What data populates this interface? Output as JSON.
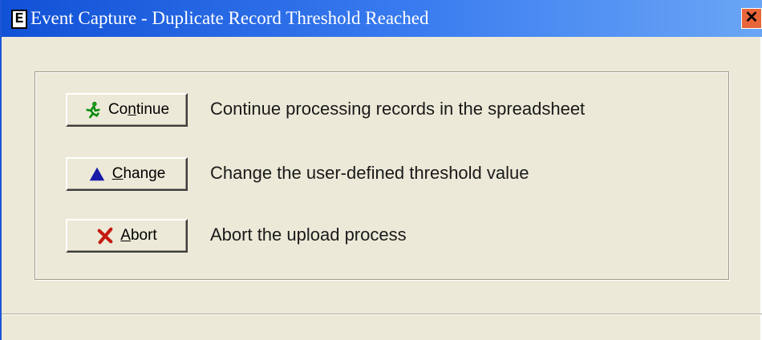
{
  "window": {
    "app_icon_letter": "E",
    "title": "Event Capture - Duplicate Record Threshold Reached",
    "close_glyph": "✕"
  },
  "options": [
    {
      "button_label_pre": "Co",
      "button_label_mnemonic": "n",
      "button_label_post": "tinue",
      "icon": "running-man-icon",
      "icon_color": "#1aa31a",
      "description": "Continue processing records in the spreadsheet"
    },
    {
      "button_label_pre": "",
      "button_label_mnemonic": "C",
      "button_label_post": "hange",
      "icon": "blue-triangle-icon",
      "icon_color": "#1a1aa8",
      "description": "Change the user-defined threshold value"
    },
    {
      "button_label_pre": "",
      "button_label_mnemonic": "A",
      "button_label_post": "bort",
      "icon": "red-x-icon",
      "icon_color": "#c41a10",
      "description": "Abort the upload process"
    }
  ],
  "colors": {
    "titlebar": "#1151d6",
    "dialog_background": "#ece9d8"
  }
}
